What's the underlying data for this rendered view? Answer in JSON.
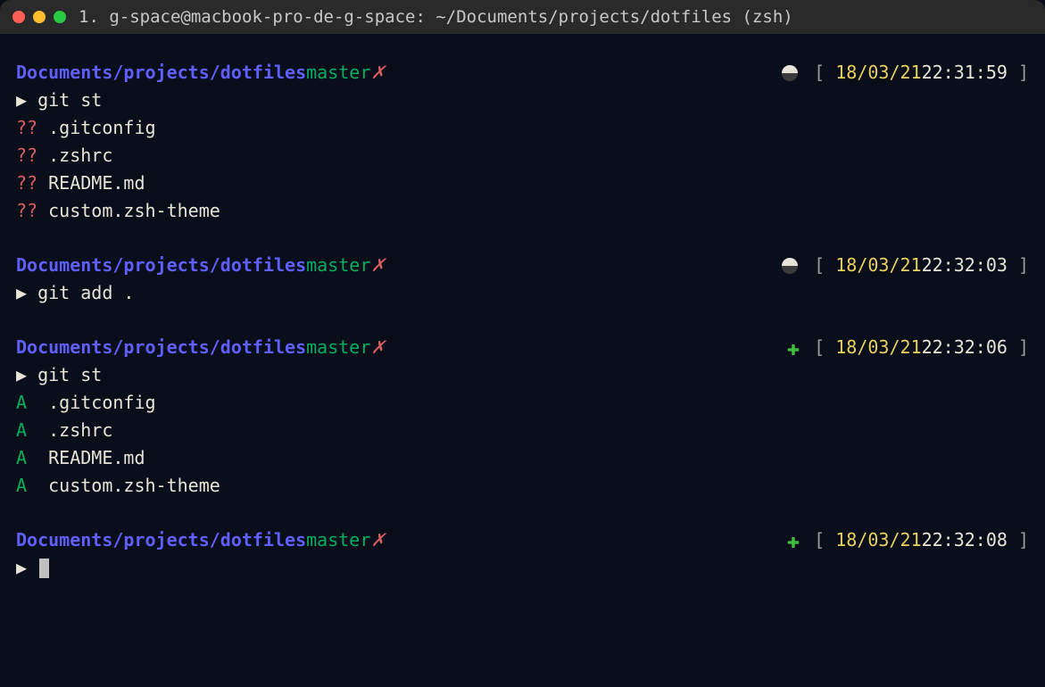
{
  "window": {
    "title": "1. g-space@macbook-pro-de-g-space: ~/Documents/projects/dotfiles (zsh)"
  },
  "blocks": [
    {
      "path": "Documents/projects/dotfiles",
      "branch": "master",
      "dirty": "✗",
      "status_icon": "circle",
      "date": "18/03/21",
      "time": "22:31:59",
      "command": "git st",
      "output": [
        {
          "prefix": "??",
          "prefix_class": "qmark",
          "file": ".gitconfig"
        },
        {
          "prefix": "??",
          "prefix_class": "qmark",
          "file": ".zshrc"
        },
        {
          "prefix": "??",
          "prefix_class": "qmark",
          "file": "README.md"
        },
        {
          "prefix": "??",
          "prefix_class": "qmark",
          "file": "custom.zsh-theme"
        }
      ]
    },
    {
      "path": "Documents/projects/dotfiles",
      "branch": "master",
      "dirty": "✗",
      "status_icon": "circle",
      "date": "18/03/21",
      "time": "22:32:03",
      "command": "git add .",
      "output": []
    },
    {
      "path": "Documents/projects/dotfiles",
      "branch": "master",
      "dirty": "✗",
      "status_icon": "plus",
      "date": "18/03/21",
      "time": "22:32:06",
      "command": "git st",
      "output": [
        {
          "prefix": "A ",
          "prefix_class": "added",
          "file": ".gitconfig"
        },
        {
          "prefix": "A ",
          "prefix_class": "added",
          "file": ".zshrc"
        },
        {
          "prefix": "A ",
          "prefix_class": "added",
          "file": "README.md"
        },
        {
          "prefix": "A ",
          "prefix_class": "added",
          "file": "custom.zsh-theme"
        }
      ]
    },
    {
      "path": "Documents/projects/dotfiles",
      "branch": "master",
      "dirty": "✗",
      "status_icon": "plus",
      "date": "18/03/21",
      "time": "22:32:08",
      "command": "",
      "cursor": true,
      "output": []
    }
  ],
  "glyphs": {
    "arrow": "▶",
    "plus": "✚",
    "bracket_open": "[ ",
    "bracket_close": " ]"
  }
}
